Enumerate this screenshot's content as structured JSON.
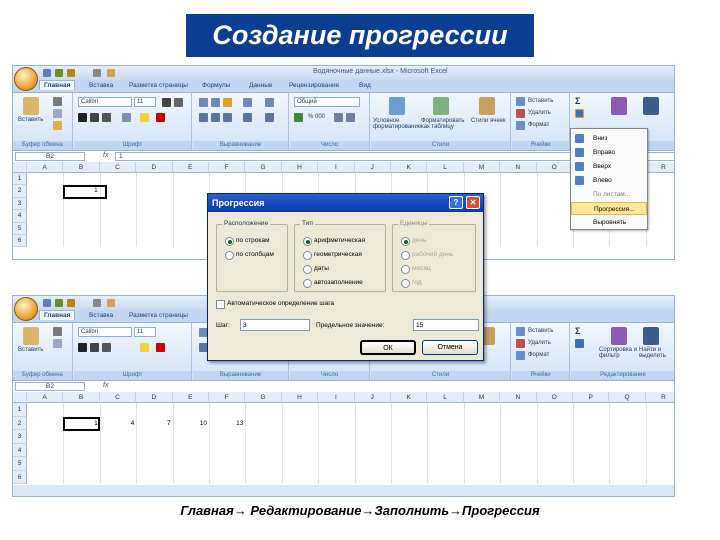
{
  "slide_title": "Создание прогрессии",
  "caption": "Главная→ Редактирование→Заполнить→Прогрессия",
  "excel": {
    "window_title": "Водяночные данные.xlsx - Microsoft Excel",
    "tabs": [
      "Главная",
      "Вставка",
      "Разметка страницы",
      "Формулы",
      "Данные",
      "Рецензирование",
      "Вид"
    ],
    "groups": [
      "Буфер обмена",
      "Шрифт",
      "Выравнивание",
      "Число",
      "Стили",
      "Ячейки",
      "Редактирование"
    ],
    "paste_label": "Вставить",
    "font_name": "Calibri",
    "font_size": "11",
    "number_format": "Общий",
    "number_symbols": "% 000",
    "style_buttons": [
      "Условное форматирование",
      "Форматировать как таблицу",
      "Стили ячеек"
    ],
    "cells_buttons": [
      "Вставить",
      "Удалить",
      "Формат"
    ],
    "edit_buttons": [
      "Сортировка и фильтр",
      "Найти и выделить"
    ],
    "name_box": "B2",
    "fx": "fx",
    "formula_value": "1",
    "columns": [
      "A",
      "B",
      "C",
      "D",
      "E",
      "F",
      "G",
      "H",
      "I",
      "J",
      "K",
      "L",
      "M",
      "N",
      "O",
      "P",
      "Q",
      "R"
    ],
    "rows": [
      "1",
      "2",
      "3",
      "4",
      "5",
      "6"
    ],
    "rows_bottom": [
      "1",
      "2",
      "3",
      "4",
      "5",
      "6"
    ],
    "top_cell_value": "1",
    "bottom_values": [
      "1",
      "4",
      "7",
      "10",
      "13"
    ]
  },
  "fill_menu": {
    "sigma": "Σ",
    "items": [
      "Вниз",
      "Вправо",
      "Вверх",
      "Влево",
      "По листам...",
      "Прогрессия...",
      "Выровнять"
    ],
    "highlighted": "Прогрессия..."
  },
  "dialog": {
    "title": "Прогрессия",
    "help": "?",
    "close": "✕",
    "location_label": "Расположение",
    "location_options": [
      "по строкам",
      "по столбцам"
    ],
    "type_label": "Тип",
    "type_options": [
      "арифметическая",
      "геометрическая",
      "даты",
      "автозаполнение"
    ],
    "units_label": "Единицы",
    "units_options": [
      "день",
      "рабочий день",
      "месяц",
      "год"
    ],
    "auto_step_label": "Автоматическое определение шага",
    "step_label": "Шаг:",
    "step_value": "3",
    "limit_label": "Предельное значение:",
    "limit_value": "15",
    "ok_label": "ОК",
    "cancel_label": "Отмена"
  }
}
